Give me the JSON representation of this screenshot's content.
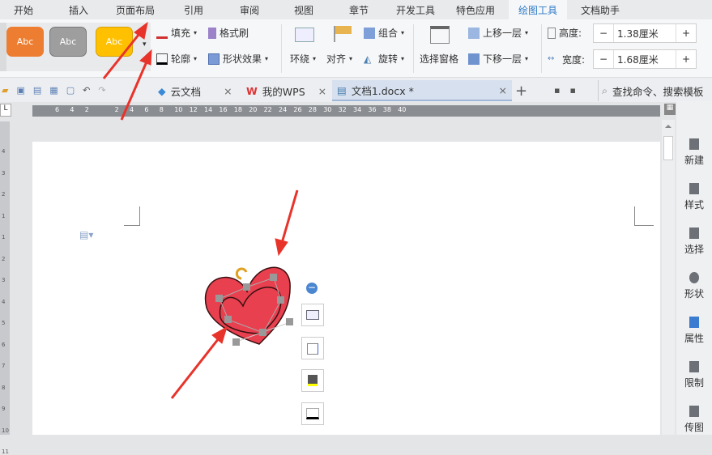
{
  "menu": [
    "开始",
    "插入",
    "页面布局",
    "引用",
    "审阅",
    "视图",
    "章节",
    "开发工具",
    "特色应用",
    "绘图工具",
    "文档助手"
  ],
  "active_menu": "绘图工具",
  "ribbon": {
    "styles": [
      {
        "label": "Abc",
        "color": "#ed7d31"
      },
      {
        "label": "Abc",
        "color": "#9e9e9e"
      },
      {
        "label": "Abc",
        "color": "#ffc000"
      }
    ],
    "fill": "填充",
    "format_painter": "格式刷",
    "outline": "轮廓",
    "shape_effect": "形状效果",
    "wrap": "环绕",
    "align": "对齐",
    "group": "组合",
    "rotate": "旋转",
    "selection_pane": "选择窗格",
    "bring_forward": "上移一层",
    "send_backward": "下移一层",
    "height_label": "高度:",
    "height_value": "1.38厘米",
    "width_label": "宽度:",
    "width_value": "1.68厘米",
    "minus": "−",
    "plus": "+"
  },
  "tabs": [
    {
      "label": "云文档"
    },
    {
      "label": "我的WPS"
    },
    {
      "label": "文档1.docx *"
    }
  ],
  "close": "×",
  "new_tab": "+",
  "search_placeholder": "查找命令、搜索模板",
  "ruler_ticks": [
    "6",
    "4",
    "2",
    "2",
    "4",
    "6",
    "8",
    "10",
    "12",
    "14",
    "16",
    "18",
    "20",
    "22",
    "24",
    "26",
    "28",
    "30",
    "32",
    "34",
    "36",
    "38",
    "40"
  ],
  "vruler_ticks": [
    "4",
    "3",
    "2",
    "1",
    "1",
    "2",
    "3",
    "4",
    "5",
    "6",
    "7",
    "8",
    "9",
    "10",
    "11"
  ],
  "ruler_corner": "L",
  "sidebar": [
    "新建",
    "样式",
    "选择",
    "形状",
    "属性",
    "限制",
    "传图"
  ]
}
